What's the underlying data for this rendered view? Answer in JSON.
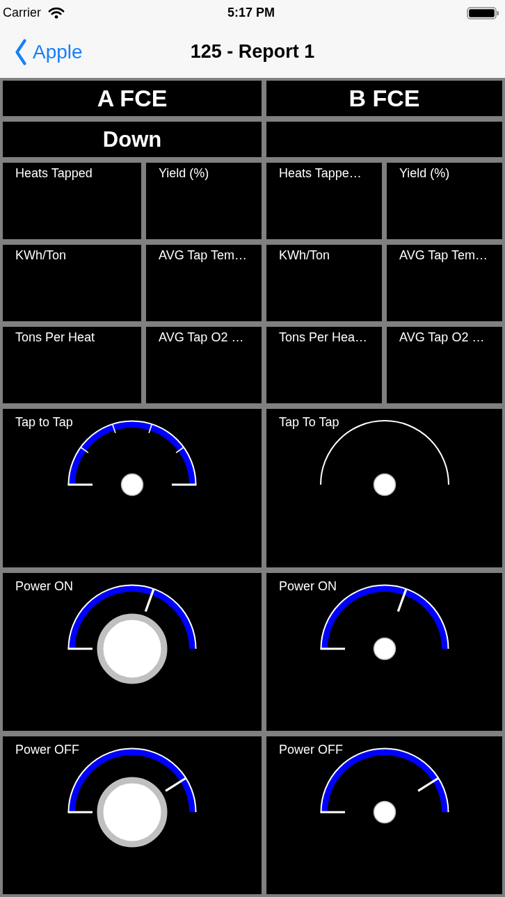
{
  "status_bar": {
    "carrier": "Carrier",
    "time": "5:17 PM"
  },
  "nav_bar": {
    "back_label": "Apple",
    "title": "125 - Report 1"
  },
  "furnaces": [
    {
      "name": "A FCE",
      "status": "Down",
      "metrics": [
        "Heats Tapped",
        "Yield (%)",
        "KWh/Ton",
        "AVG Tap Tem…",
        "Tons Per Heat",
        "AVG Tap O2 …"
      ],
      "gauges": [
        {
          "title": "Tap to Tap",
          "kind": "ticked",
          "hub_enlarged": false
        },
        {
          "title": "Power ON",
          "kind": "needle",
          "level": 0.61,
          "hub_enlarged": true
        },
        {
          "title": "Power OFF",
          "kind": "needle",
          "level": 0.82,
          "hub_enlarged": true
        }
      ]
    },
    {
      "name": "B FCE",
      "metrics": [
        "Heats Tappe…",
        "Yield (%)",
        "KWh/Ton",
        "AVG Tap Tem…",
        "Tons Per Hea…",
        "AVG Tap O2 …"
      ],
      "gauges": [
        {
          "title": "Tap To Tap",
          "kind": "outline",
          "hub_enlarged": false
        },
        {
          "title": "Power ON",
          "kind": "needle",
          "level": 0.61,
          "hub_enlarged": false
        },
        {
          "title": "Power OFF",
          "kind": "needle",
          "level": 0.82,
          "hub_enlarged": false
        }
      ]
    }
  ]
}
